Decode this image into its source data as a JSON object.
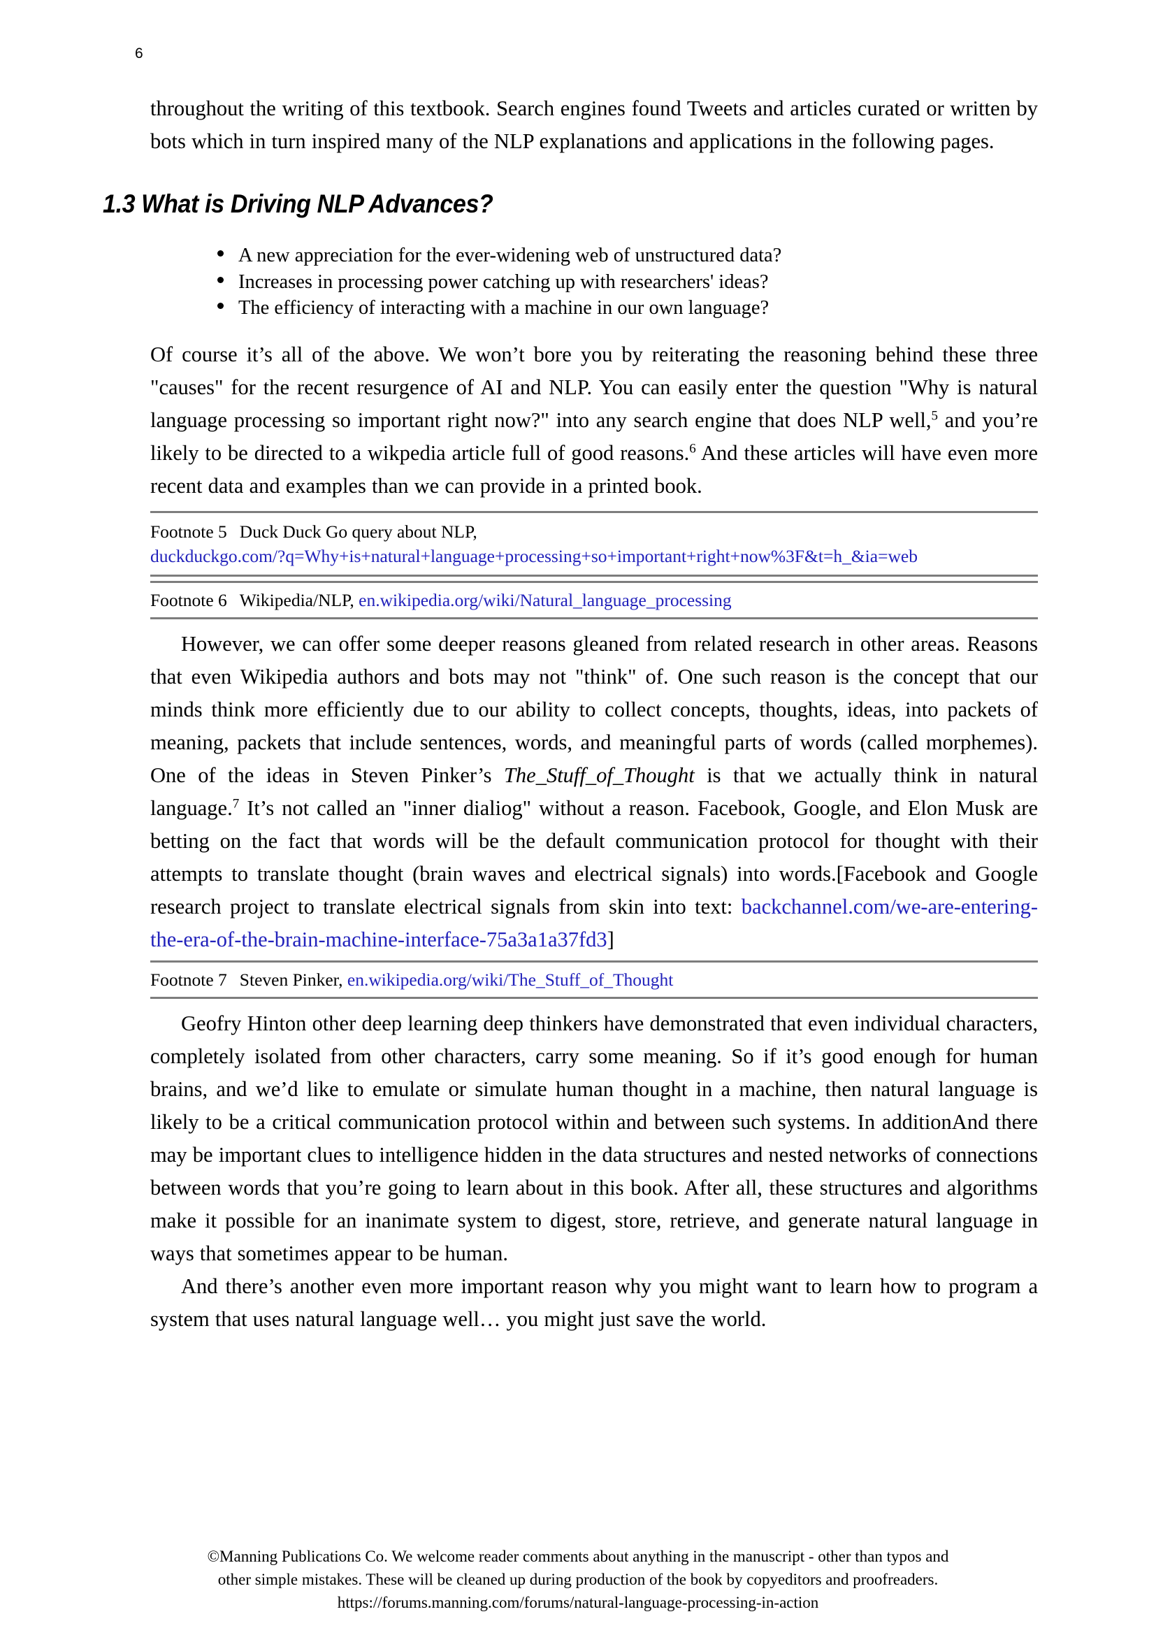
{
  "page": {
    "number": "6"
  },
  "body": {
    "para_top": "throughout the writing of this textbook. Search engines found Tweets and articles curated or written by bots which in turn inspired many of the NLP explanations and applications in the following pages.",
    "heading": "1.3 What is Driving NLP Advances?",
    "bullets": [
      "A new appreciation for the ever-widening web of unstructured data?",
      "Increases in processing power catching up with researchers' ideas?",
      "The efficiency of interacting with a machine in our own language?"
    ],
    "para_of_course_1": "Of course it’s all of the above. We won’t bore you by reiterating the reasoning behind these three \"causes\" for the recent resurgence of AI and NLP. You can easily enter the question \"Why is natural language processing so important right now?\" into any search engine that does NLP well,",
    "para_of_course_ref1": "5",
    "para_of_course_2": " and you’re likely to be directed to a wikpedia article full of good reasons.",
    "para_of_course_ref2": "6",
    "para_of_course_3": " And these articles will have even more recent data and examples than we can provide in a printed book.",
    "para_however_1": "However, we can offer some deeper reasons gleaned from related research in other areas. Reasons that even Wikipedia authors and bots may not \"think\" of. One such reason is the concept that our minds think more efficiently due to our ability to collect concepts, thoughts, ideas, into packets of meaning, packets that include sentences, words, and meaningful parts of words (called morphemes). One of the ideas in Steven Pinker’s ",
    "para_however_italic": "The_Stuff_of_Thought",
    "para_however_2": " is that we actually think in natural language.",
    "para_however_ref": "7",
    "para_however_3": " It’s not called an \"inner dialiog\" without a reason. Facebook, Google, and Elon Musk are betting on the fact that words will be the default communication protocol for thought with their attempts to translate thought (brain waves and electrical signals) into words.[Facebook and Google research project to translate electrical signals from skin into text: ",
    "para_however_link": "backchannel.com/we-are-entering-the-era-of-the-brain-machine-interface-75a3a1a37fd3",
    "para_however_4": "]",
    "para_geofry": "Geofry Hinton other deep learning deep thinkers have demonstrated that even individual characters, completely isolated from other characters, carry some meaning. So if it’s good enough for human brains, and we’d like to emulate or simulate human thought in a machine, then natural language is likely to be a critical communication protocol within and between such systems. In additionAnd there may be important clues to intelligence hidden in the data structures and nested networks of connections between words that you’re going to learn about in this book. After all, these structures and algorithms make it possible for an inanimate system to digest, store, retrieve, and generate natural language in ways that sometimes appear to be human.",
    "para_another": "And there’s another even more important reason why you might want to learn how to program a system that uses natural language well… you might just save the world."
  },
  "footnotes": [
    {
      "label": "Footnote 5",
      "text": "Duck Duck Go query about NLP,",
      "link": "duckduckgo.com/?q=Why+is+natural+language+processing+so+important+right+now%3F&t=h_&ia=web"
    },
    {
      "label": "Footnote 6",
      "text": "Wikipedia/NLP,",
      "link": "en.wikipedia.org/wiki/Natural_language_processing"
    },
    {
      "label": "Footnote 7",
      "text": "Steven Pinker,",
      "link": "en.wikipedia.org/wiki/The_Stuff_of_Thought"
    }
  ],
  "footer": {
    "line1": "©Manning Publications Co. We welcome reader comments about anything in the manuscript - other than typos and",
    "line2": "other simple mistakes. These will be cleaned up during production of the book by copyeditors and proofreaders.",
    "line3": "https://forums.manning.com/forums/natural-language-processing-in-action"
  },
  "colors": {
    "link": "#2222bb",
    "rule": "#7d7d7d",
    "text": "#000000"
  }
}
